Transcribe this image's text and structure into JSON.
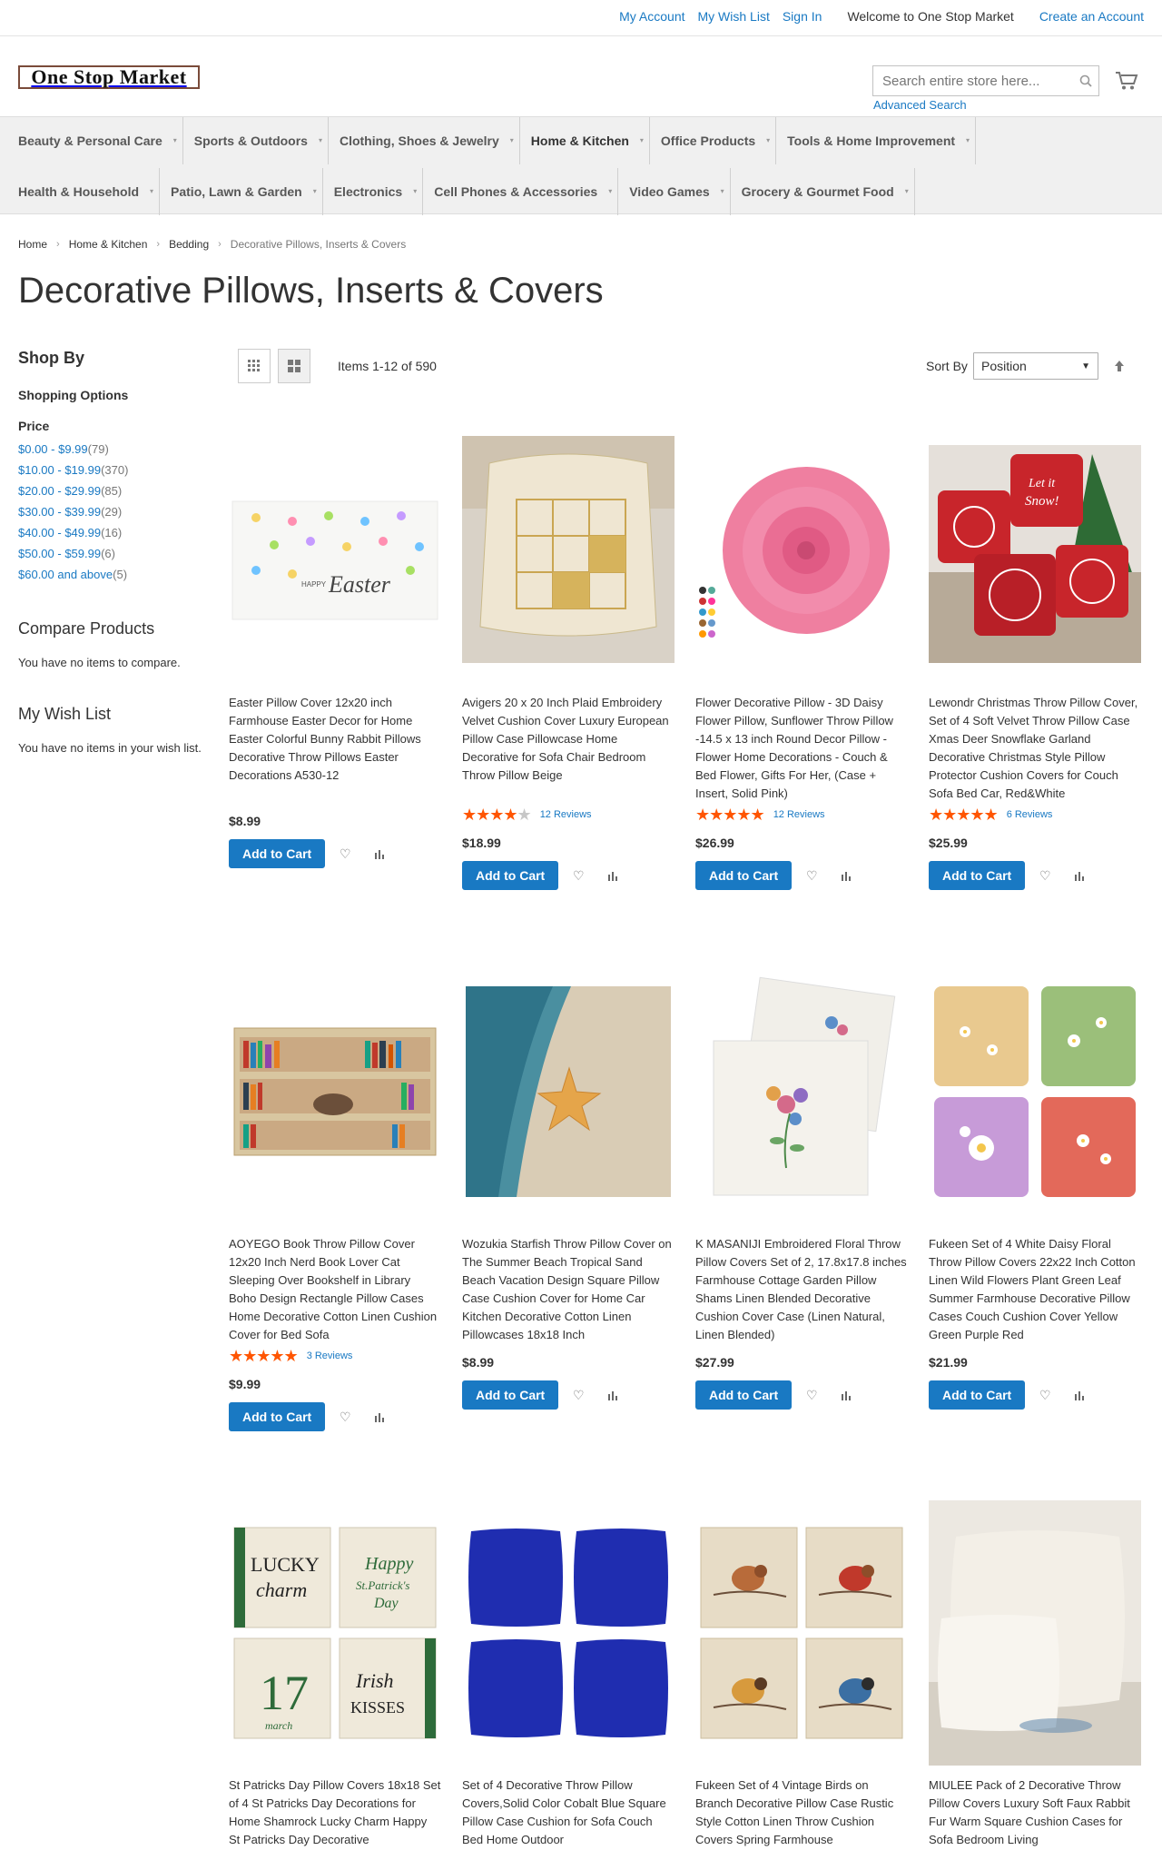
{
  "topbar": {
    "my_account": "My Account",
    "my_wish_list": "My Wish List",
    "sign_in": "Sign In",
    "welcome": "Welcome to One Stop Market",
    "create_account": "Create an Account"
  },
  "header": {
    "logo_text": "One Stop Market",
    "search_placeholder": "Search entire store here...",
    "advanced_search": "Advanced Search"
  },
  "nav": {
    "row1": [
      "Beauty & Personal Care",
      "Sports & Outdoors",
      "Clothing, Shoes & Jewelry",
      "Home & Kitchen",
      "Office Products",
      "Tools & Home Improvement"
    ],
    "row2": [
      "Health & Household",
      "Patio, Lawn & Garden",
      "Electronics",
      "Cell Phones & Accessories",
      "Video Games",
      "Grocery & Gourmet Food"
    ]
  },
  "breadcrumbs": [
    "Home",
    "Home & Kitchen",
    "Bedding",
    "Decorative Pillows, Inserts & Covers"
  ],
  "page_title": "Decorative Pillows, Inserts & Covers",
  "sidebar": {
    "shop_by": "Shop By",
    "shopping_options": "Shopping Options",
    "price_title": "Price",
    "price_filters": [
      {
        "range": "$0.00 - $9.99",
        "count": "79"
      },
      {
        "range": "$10.00 - $19.99",
        "count": "370"
      },
      {
        "range": "$20.00 - $29.99",
        "count": "85"
      },
      {
        "range": "$30.00 - $39.99",
        "count": "29"
      },
      {
        "range": "$40.00 - $49.99",
        "count": "16"
      },
      {
        "range": "$50.00 - $59.99",
        "count": "6"
      },
      {
        "range": "$60.00 and above",
        "count": "5"
      }
    ],
    "compare_title": "Compare Products",
    "compare_text": "You have no items to compare.",
    "wishlist_title": "My Wish List",
    "wishlist_text": "You have no items in your wish list."
  },
  "toolbar": {
    "amount": "Items 1-12 of 590",
    "sort_label": "Sort By",
    "sort_value": "Position"
  },
  "products": [
    {
      "name": "Easter Pillow Cover 12x20 inch Farmhouse Easter Decor for Home Easter Colorful Bunny Rabbit Pillows Decorative Throw Pillows Easter Decorations A530-12",
      "price": "$8.99",
      "rating": 0,
      "reviews": "",
      "add_to_cart": "Add to Cart"
    },
    {
      "name": "Avigers 20 x 20 Inch Plaid Embroidery Velvet Cushion Cover Luxury European Pillow Case Pillowcase Home Decorative for Sofa Chair Bedroom Throw Pillow Beige",
      "price": "$18.99",
      "rating": 4,
      "reviews": "12  Reviews",
      "add_to_cart": "Add to Cart"
    },
    {
      "name": "Flower Decorative Pillow - 3D Daisy Flower Pillow, Sunflower Throw Pillow -14.5 x 13 inch Round Decor Pillow - Flower Home Decorations - Couch & Bed Flower, Gifts For Her, (Case + Insert, Solid Pink)",
      "price": "$26.99",
      "rating": 5,
      "reviews": "12  Reviews",
      "add_to_cart": "Add to Cart"
    },
    {
      "name": "Lewondr Christmas Throw Pillow Cover, Set of 4 Soft Velvet Throw Pillow Case Xmas Deer Snowflake Garland Decorative Christmas Style Pillow Protector Cushion Covers for Couch Sofa Bed Car, Red&White",
      "price": "$25.99",
      "rating": 5,
      "reviews": "6  Reviews",
      "add_to_cart": "Add to Cart"
    },
    {
      "name": "AOYEGO Book Throw Pillow Cover 12x20 Inch Nerd Book Lover Cat Sleeping Over Bookshelf in Library Boho Design Rectangle Pillow Cases Home Decorative Cotton Linen Cushion Cover for Bed Sofa",
      "price": "$9.99",
      "rating": 5,
      "reviews": "3  Reviews",
      "add_to_cart": "Add to Cart"
    },
    {
      "name": "Wozukia Starfish Throw Pillow Cover on The Summer Beach Tropical Sand Beach Vacation Design Square Pillow Case Cushion Cover for Home Car Kitchen Decorative Cotton Linen Pillowcases 18x18 Inch",
      "price": "$8.99",
      "rating": 0,
      "reviews": "",
      "add_to_cart": "Add to Cart"
    },
    {
      "name": "K MASANIJI Embroidered Floral Throw Pillow Covers Set of 2, 17.8x17.8 inches Farmhouse Cottage Garden Pillow Shams Linen Blended Decorative Cushion Cover Case (Linen Natural, Linen Blended)",
      "price": "$27.99",
      "rating": 0,
      "reviews": "",
      "add_to_cart": "Add to Cart"
    },
    {
      "name": "Fukeen Set of 4 White Daisy Floral Throw Pillow Covers 22x22 Inch Cotton Linen Wild Flowers Plant Green Leaf Summer Farmhouse Decorative Pillow Cases Couch Cushion Cover Yellow Green Purple Red",
      "price": "$21.99",
      "rating": 0,
      "reviews": "",
      "add_to_cart": "Add to Cart"
    },
    {
      "name": "St Patricks Day Pillow Covers 18x18 Set of 4 St Patricks Day Decorations for Home Shamrock Lucky Charm Happy St Patricks Day Decorative",
      "price": "",
      "rating": 0,
      "reviews": "",
      "add_to_cart": ""
    },
    {
      "name": "Set of 4 Decorative Throw Pillow Covers,Solid Color Cobalt Blue Square Pillow Case Cushion for Sofa Couch Bed Home Outdoor",
      "price": "",
      "rating": 0,
      "reviews": "",
      "add_to_cart": ""
    },
    {
      "name": "Fukeen Set of 4 Vintage Birds on Branch Decorative Pillow Case Rustic Style Cotton Linen Throw Cushion Covers Spring Farmhouse",
      "price": "",
      "rating": 0,
      "reviews": "",
      "add_to_cart": ""
    },
    {
      "name": "MIULEE Pack of 2 Decorative Throw Pillow Covers Luxury Soft Faux Rabbit Fur Warm Square Cushion Cases for Sofa Bedroom Living",
      "price": "",
      "rating": 0,
      "reviews": "",
      "add_to_cart": ""
    }
  ],
  "images": {
    "easter_text": "Easter",
    "happy_text": "HAPPY",
    "letit_text": "Let it",
    "snow_text": "Snow!",
    "lucky_text": "LUCKY",
    "charm_text": "charm",
    "num17_text": "17",
    "march_text": "march",
    "happy2_text": "Happy",
    "stp_text": "St.Patrick's",
    "day_text": "Day",
    "irish_text": "Irish",
    "kisses_text": "KISSES"
  },
  "colors": {
    "link": "#1979c3",
    "button": "#1979c3",
    "star": "#ff5501",
    "nav_bg": "#f0f0f0"
  }
}
